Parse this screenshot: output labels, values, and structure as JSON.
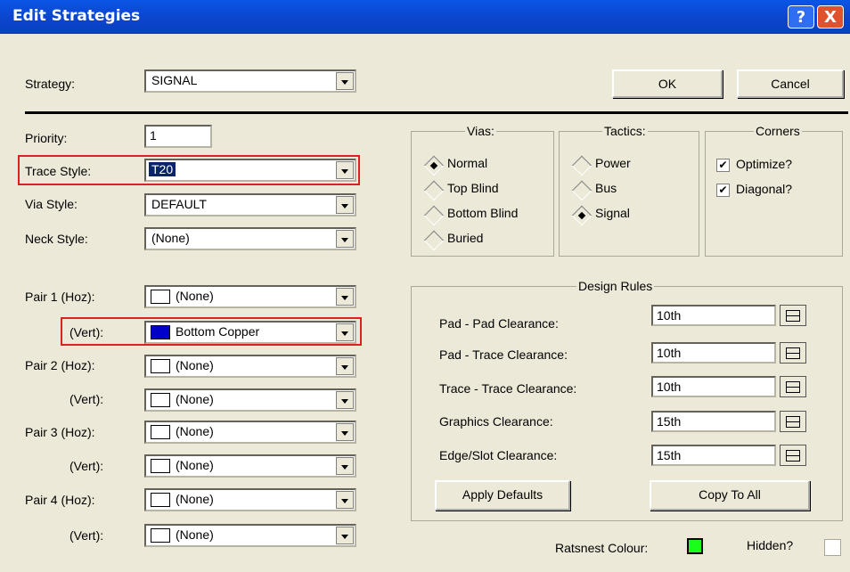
{
  "window": {
    "title": "Edit Strategies",
    "help_label": "?",
    "close_label": "X"
  },
  "strategy": {
    "label": "Strategy:",
    "value": "SIGNAL"
  },
  "buttons": {
    "ok": "OK",
    "cancel": "Cancel",
    "apply_defaults": "Apply Defaults",
    "copy_to_all": "Copy To All"
  },
  "priority": {
    "label": "Priority:",
    "value": "1"
  },
  "trace_style": {
    "label": "Trace Style:",
    "value": "T20"
  },
  "via_style": {
    "label": "Via Style:",
    "value": "DEFAULT"
  },
  "neck_style": {
    "label": "Neck Style:",
    "value": "(None)"
  },
  "pairs": [
    {
      "label": "Pair 1 (Hoz):",
      "value": "(None)",
      "color": "#ffffff"
    },
    {
      "label": "(Vert):",
      "value": "Bottom Copper",
      "color": "#0000c8"
    },
    {
      "label": "Pair 2 (Hoz):",
      "value": "(None)",
      "color": "#ffffff"
    },
    {
      "label": "(Vert):",
      "value": "(None)",
      "color": "#ffffff"
    },
    {
      "label": "Pair 3 (Hoz):",
      "value": "(None)",
      "color": "#ffffff"
    },
    {
      "label": "(Vert):",
      "value": "(None)",
      "color": "#ffffff"
    },
    {
      "label": "Pair 4 (Hoz):",
      "value": "(None)",
      "color": "#ffffff"
    },
    {
      "label": "(Vert):",
      "value": "(None)",
      "color": "#ffffff"
    }
  ],
  "vias": {
    "title": "Vias:",
    "options": [
      "Normal",
      "Top Blind",
      "Bottom Blind",
      "Buried"
    ],
    "selected": "Normal"
  },
  "tactics": {
    "title": "Tactics:",
    "options": [
      "Power",
      "Bus",
      "Signal"
    ],
    "selected": "Signal"
  },
  "corners": {
    "title": "Corners",
    "optimize": "Optimize?",
    "diagonal": "Diagonal?"
  },
  "design_rules": {
    "title": "Design Rules",
    "rows": [
      {
        "label": "Pad - Pad Clearance:",
        "value": "10th"
      },
      {
        "label": "Pad - Trace Clearance:",
        "value": "10th"
      },
      {
        "label": "Trace - Trace Clearance:",
        "value": "10th"
      },
      {
        "label": "Graphics Clearance:",
        "value": "15th"
      },
      {
        "label": "Edge/Slot Clearance:",
        "value": "15th"
      }
    ]
  },
  "ratsnest": {
    "label": "Ratsnest Colour:",
    "color": "#1aff1a"
  },
  "hidden": {
    "label": "Hidden?"
  },
  "colors": {
    "titlebar": "#0a46d2",
    "highlight": "#e02020",
    "dialog_bg": "#ece9d8"
  }
}
